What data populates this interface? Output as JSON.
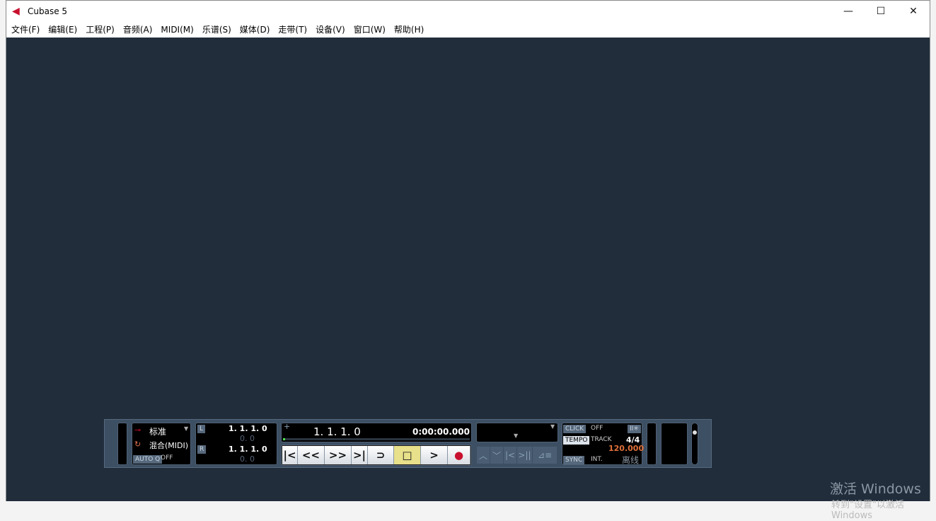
{
  "window": {
    "title": "Cubase 5",
    "minimize": "—",
    "maximize": "☐",
    "close": "✕"
  },
  "menu": [
    "文件(F)",
    "编辑(E)",
    "工程(P)",
    "音频(A)",
    "MIDI(M)",
    "乐谱(S)",
    "媒体(D)",
    "走带(T)",
    "设备(V)",
    "窗口(W)",
    "帮助(H)"
  ],
  "transport": {
    "record_mode": "标准",
    "cycle_mode": "混合(MIDI)",
    "autoq_label": "AUTO Q",
    "autoq_value": "OFF",
    "left_locator": "1. 1. 1.   0",
    "left_offset": "0.   0",
    "right_locator": "1. 1. 1.   0",
    "right_offset": "0.   0",
    "position_primary": "1. 1. 1.   0",
    "position_secondary": "0:00:00.000",
    "progress": 0.01,
    "click_label": "CLICK",
    "click_value": "OFF",
    "tempo_label": "TEMPO",
    "tempo_mode": "TRACK",
    "signature": "4/4",
    "tempo": "120.000",
    "sync_label": "SYNC",
    "sync_value": "INT.",
    "sync_status": "离线",
    "buttons": {
      "go_start": "|<",
      "rewind": "<<",
      "forward": ">>",
      "go_end": ">|",
      "cycle": "⊃",
      "stop": "□",
      "play": ">",
      "record": "●"
    },
    "colors": {
      "tempo": "#e0703a",
      "record": "#c8102e",
      "stop_bg": "#e8e08a"
    }
  },
  "watermark": {
    "line1": "激活 Windows",
    "line2": "转到\"设置\"以激活 Windows"
  }
}
